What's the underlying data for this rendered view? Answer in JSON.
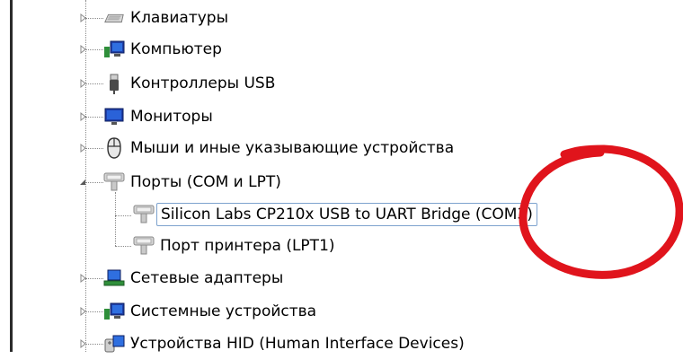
{
  "tree": {
    "items": [
      {
        "label": "Клавиатуры",
        "icon": "keyboard-icon",
        "expander": "collapsed"
      },
      {
        "label": "Компьютер",
        "icon": "computer-icon",
        "expander": "collapsed"
      },
      {
        "label": "Контроллеры USB",
        "icon": "usb-icon",
        "expander": "collapsed"
      },
      {
        "label": "Мониторы",
        "icon": "monitor-icon",
        "expander": "collapsed"
      },
      {
        "label": "Мыши и иные указывающие устройства",
        "icon": "mouse-icon",
        "expander": "collapsed"
      },
      {
        "label": "Порты (COM и LPT)",
        "icon": "port-icon",
        "expander": "expanded"
      },
      {
        "label": "Silicon Labs CP210x USB to UART Bridge (COM3)",
        "icon": "port-icon",
        "selected": true
      },
      {
        "label": "Порт принтера (LPT1)",
        "icon": "port-icon"
      },
      {
        "label": "Сетевые адаптеры",
        "icon": "network-adapter-icon",
        "expander": "collapsed"
      },
      {
        "label": "Системные устройства",
        "icon": "computer-icon",
        "expander": "collapsed"
      },
      {
        "label": "Устройства HID (Human Interface Devices)",
        "icon": "hid-icon",
        "expander": "collapsed"
      }
    ]
  },
  "colors": {
    "selection_border": "#7da2ce",
    "annotation": "#e0141c",
    "tree_line": "#8a8a8a"
  }
}
